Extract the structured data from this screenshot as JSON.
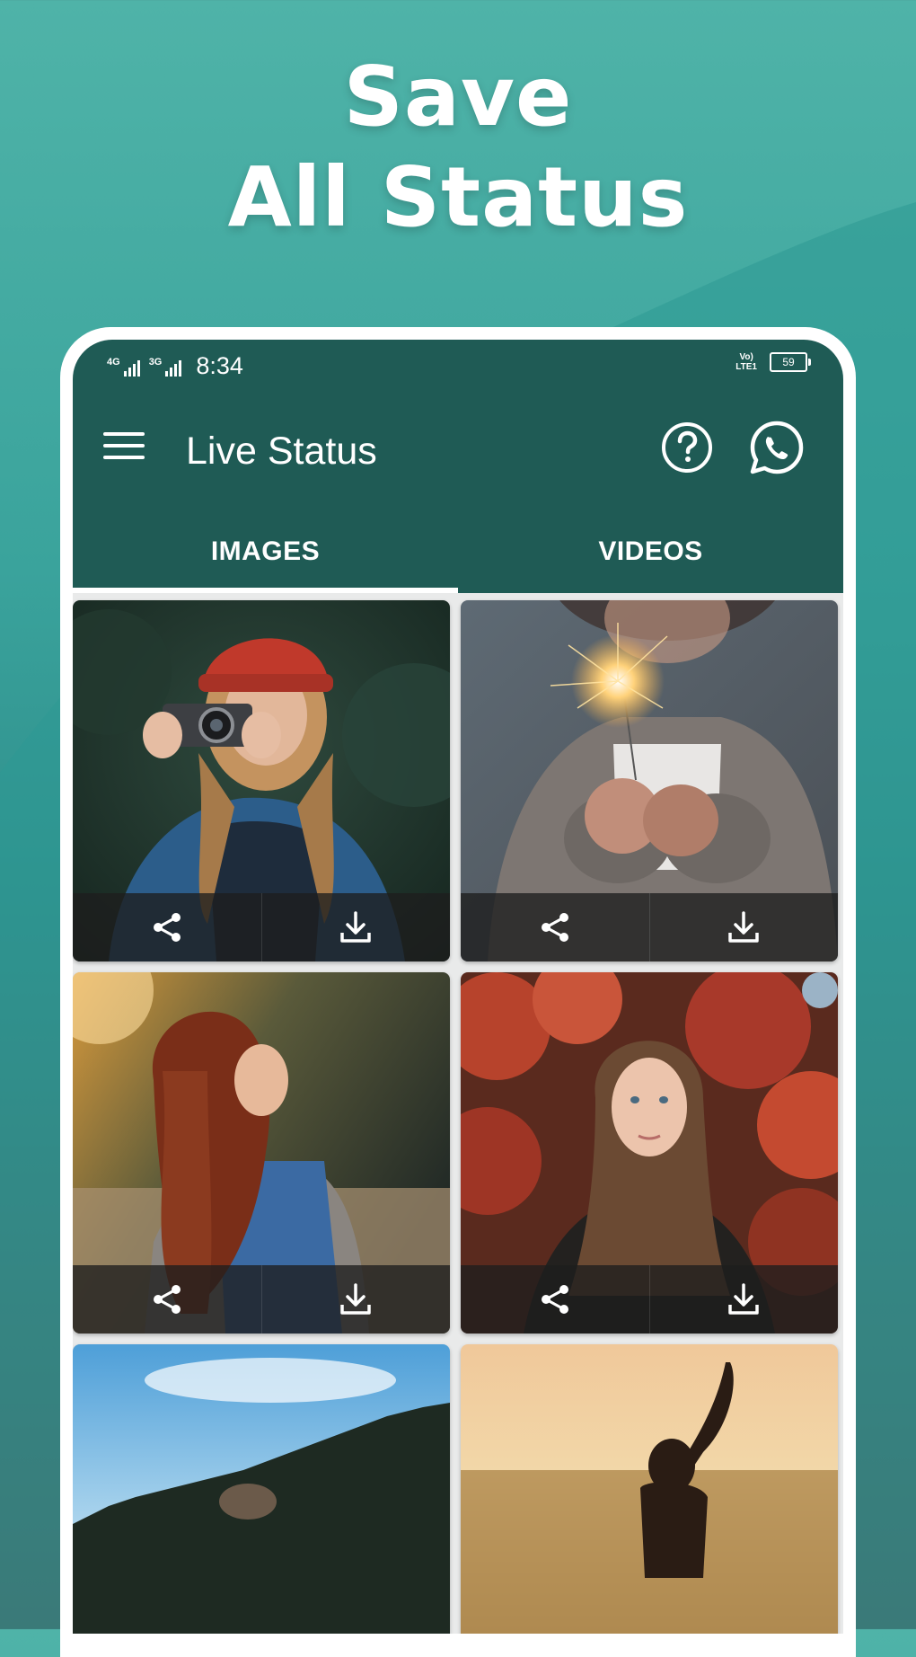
{
  "promo": {
    "line1": "Save",
    "line2": "All Status"
  },
  "status_bar": {
    "sim1_network": "4G",
    "sim2_network": "3G",
    "time": "8:34",
    "volte_line1": "Vo)",
    "volte_line2": "LTE1",
    "battery": "59"
  },
  "app_bar": {
    "title": "Live Status",
    "menu_icon": "hamburger-menu-icon",
    "help_icon": "question-circle-icon",
    "whatsapp_icon": "whatsapp-icon"
  },
  "tabs": [
    {
      "label": "IMAGES",
      "selected": true
    },
    {
      "label": "VIDEOS",
      "selected": false
    }
  ],
  "colors": {
    "app_bar": "#1f5b55",
    "promo_bg_top": "#4fb3a8",
    "promo_bg_bottom": "#4a5558",
    "tab_indicator": "#ffffff"
  },
  "status_items": [
    {
      "description": "woman in red beanie with camera",
      "share_icon": "share-icon",
      "download_icon": "download-icon"
    },
    {
      "description": "hands holding a sparkler",
      "share_icon": "share-icon",
      "download_icon": "download-icon"
    },
    {
      "description": "woman with long red hair in denim vest at sunset",
      "share_icon": "share-icon",
      "download_icon": "download-icon"
    },
    {
      "description": "woman portrait in front of red foliage",
      "share_icon": "share-icon",
      "download_icon": "download-icon"
    },
    {
      "description": "sky and treeline landscape",
      "share_icon": "share-icon",
      "download_icon": "download-icon"
    },
    {
      "description": "woman raising arm in a golden field",
      "share_icon": "share-icon",
      "download_icon": "download-icon"
    }
  ]
}
